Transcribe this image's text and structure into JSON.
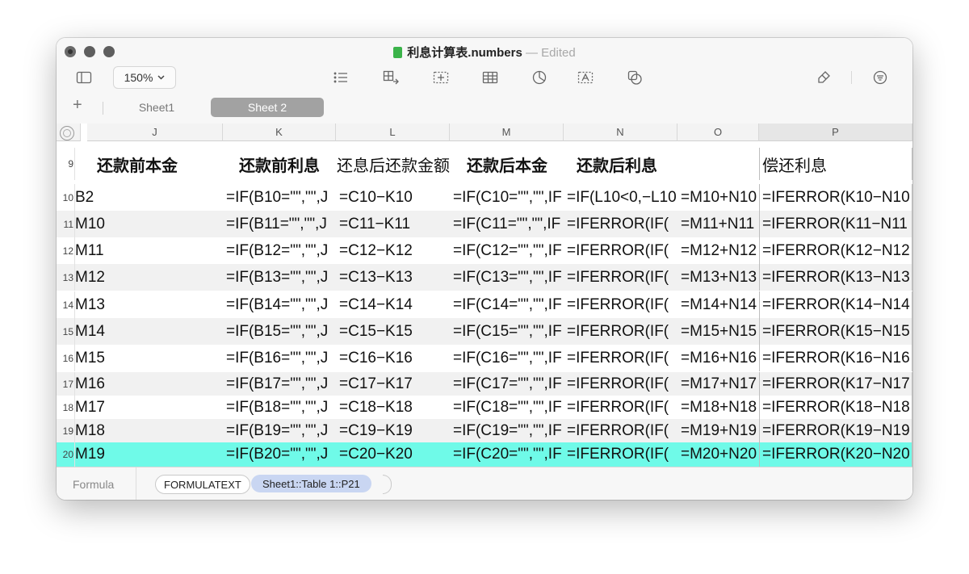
{
  "window": {
    "doc_name": "利息计算表.numbers",
    "title_sep": "—",
    "edited": "Edited"
  },
  "toolbar": {
    "zoom": "150%",
    "icons": [
      "sidebar-icon",
      "list-icon",
      "insert-table-add-icon",
      "text-box-icon",
      "table-icon",
      "chart-icon",
      "text-icon",
      "shape-icon",
      "format-brush-icon",
      "organize-icon"
    ]
  },
  "tabs": {
    "add": "+",
    "sheet1": "Sheet1",
    "sheet2": "Sheet 2"
  },
  "columns": [
    "J",
    "K",
    "L",
    "M",
    "N",
    "O",
    "P"
  ],
  "header_row": {
    "num": "9",
    "cells": [
      "还款前本金",
      "还款前利息",
      "还息后还款金额",
      "还款后本金",
      "还款后利息",
      "",
      "偿还利息"
    ]
  },
  "rows": [
    {
      "num": "10",
      "cells": [
        "B2",
        "=IF(B10=\"\",\"\",J",
        "=C10−K10",
        "=IF(C10=\"\",\"\",IF",
        "=IF(L10<0,−L10",
        "=M10+N10",
        "=IFERROR(K10−N10"
      ]
    },
    {
      "num": "11",
      "cells": [
        "M10",
        "=IF(B11=\"\",\"\",J",
        "=C11−K11",
        "=IF(C11=\"\",\"\",IF",
        "=IFERROR(IF(",
        "=M11+N11",
        "=IFERROR(K11−N11"
      ]
    },
    {
      "num": "12",
      "cells": [
        "M11",
        "=IF(B12=\"\",\"\",J",
        "=C12−K12",
        "=IF(C12=\"\",\"\",IF",
        "=IFERROR(IF(",
        "=M12+N12",
        "=IFERROR(K12−N12"
      ]
    },
    {
      "num": "13",
      "cells": [
        "M12",
        "=IF(B13=\"\",\"\",J",
        "=C13−K13",
        "=IF(C13=\"\",\"\",IF",
        "=IFERROR(IF(",
        "=M13+N13",
        "=IFERROR(K13−N13"
      ]
    },
    {
      "num": "14",
      "cells": [
        "M13",
        "=IF(B14=\"\",\"\",J",
        "=C14−K14",
        "=IF(C14=\"\",\"\",IF",
        "=IFERROR(IF(",
        "=M14+N14",
        "=IFERROR(K14−N14"
      ]
    },
    {
      "num": "15",
      "cells": [
        "M14",
        "=IF(B15=\"\",\"\",J",
        "=C15−K15",
        "=IF(C15=\"\",\"\",IF",
        "=IFERROR(IF(",
        "=M15+N15",
        "=IFERROR(K15−N15"
      ]
    },
    {
      "num": "16",
      "cells": [
        "M15",
        "=IF(B16=\"\",\"\",J",
        "=C16−K16",
        "=IF(C16=\"\",\"\",IF",
        "=IFERROR(IF(",
        "=M16+N16",
        "=IFERROR(K16−N16"
      ]
    },
    {
      "num": "17",
      "cells": [
        "M16",
        "=IF(B17=\"\",\"\",J",
        "=C17−K17",
        "=IF(C17=\"\",\"\",IF",
        "=IFERROR(IF(",
        "=M17+N17",
        "=IFERROR(K17−N17"
      ]
    },
    {
      "num": "18",
      "cells": [
        "M17",
        "=IF(B18=\"\",\"\",J",
        "=C18−K18",
        "=IF(C18=\"\",\"\",IF",
        "=IFERROR(IF(",
        "=M18+N18",
        "=IFERROR(K18−N18"
      ]
    },
    {
      "num": "19",
      "cells": [
        "M18",
        "=IF(B19=\"\",\"\",J",
        "=C19−K19",
        "=IF(C19=\"\",\"\",IF",
        "=IFERROR(IF(",
        "=M19+N19",
        "=IFERROR(K19−N19"
      ]
    },
    {
      "num": "20",
      "cells": [
        "M19",
        "=IF(B20=\"\",\"\",J",
        "=C20−K20",
        "=IF(C20=\"\",\"\",IF",
        "=IFERROR(IF(",
        "=M20+N20",
        "=IFERROR(K20−N20"
      ]
    }
  ],
  "formula_bar": {
    "label": "Formula",
    "function_token": "FORMULATEXT",
    "reference_token": "Sheet1::Table 1::P21"
  },
  "colors": {
    "selected_row": "#6ffae8",
    "reference_token": "#c9d6f2",
    "active_tab": "#a2a2a2"
  }
}
